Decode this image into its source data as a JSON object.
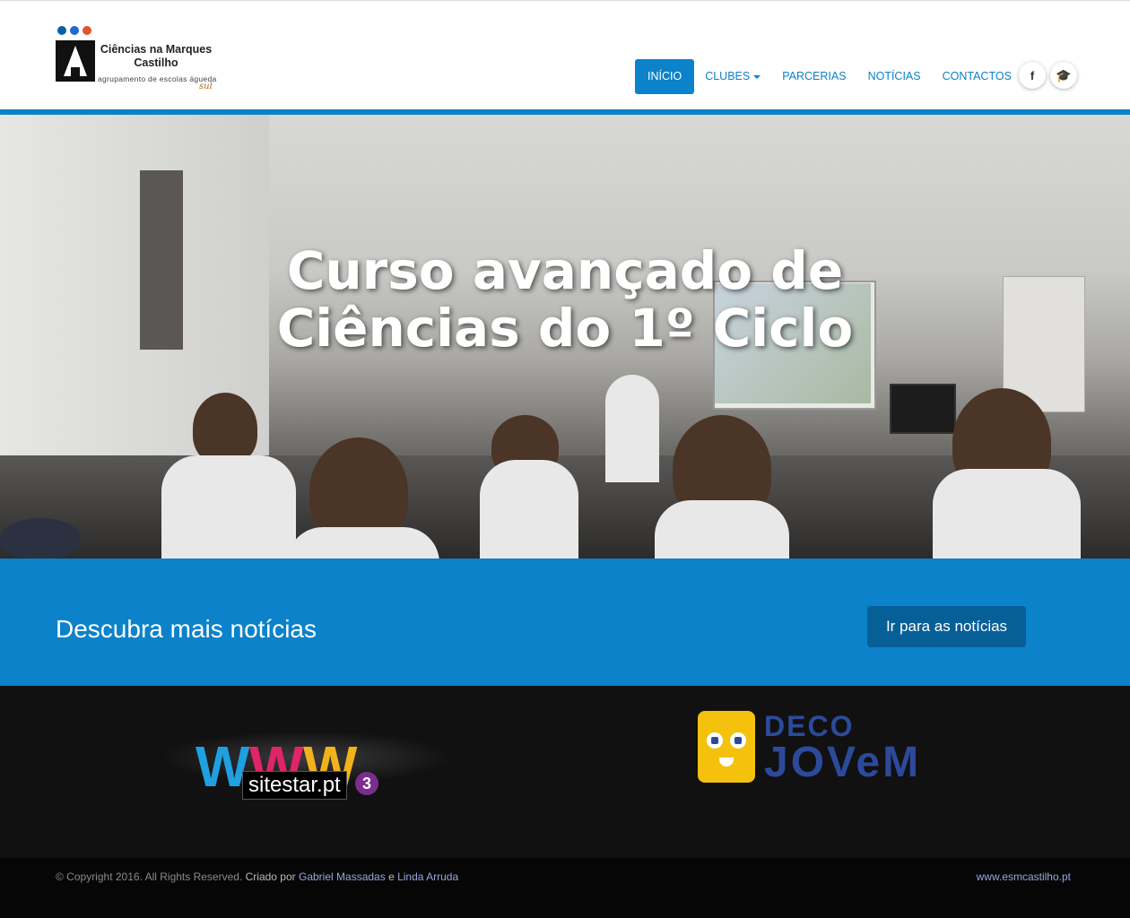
{
  "logo": {
    "title": "Ciências na Marques Castilho",
    "subtitle": "agrupamento de escolas águeda",
    "swash": "sul",
    "dot_colors": [
      "#0b5fa5",
      "#1e6ad1",
      "#e0552a"
    ]
  },
  "nav": {
    "items": [
      {
        "label": "INÍCIO",
        "active": true
      },
      {
        "label": "CLUBES",
        "dropdown": true
      },
      {
        "label": "PARCERIAS"
      },
      {
        "label": "NOTÍCIAS"
      },
      {
        "label": "CONTACTOS"
      }
    ],
    "social": [
      {
        "icon": "facebook-icon",
        "glyph": "f"
      },
      {
        "icon": "graduation-cap-icon",
        "glyph": "🎓"
      }
    ]
  },
  "hero": {
    "title_line1": "Curso avançado de",
    "title_line2": "Ciências do 1º Ciclo"
  },
  "cta": {
    "text": "Descubra mais notícias",
    "button": "Ir para as notícias"
  },
  "partners": {
    "sitestar": {
      "label": "sitestar.pt",
      "number": "3"
    },
    "deco": {
      "top": "DECO",
      "bottom": "JOVeM"
    }
  },
  "footer": {
    "copyright": "© Copyright 2016. All Rights Reserved.",
    "created_by": "Criado por",
    "author1": "Gabriel Massadas",
    "and": "e",
    "author2": "Linda Arruda",
    "site": "www.esmcastilho.pt"
  },
  "colors": {
    "accent": "#0b82c9",
    "footer_link": "#9aa6e0",
    "deco_yellow": "#f4c20d",
    "deco_blue": "#2d4a9a"
  }
}
